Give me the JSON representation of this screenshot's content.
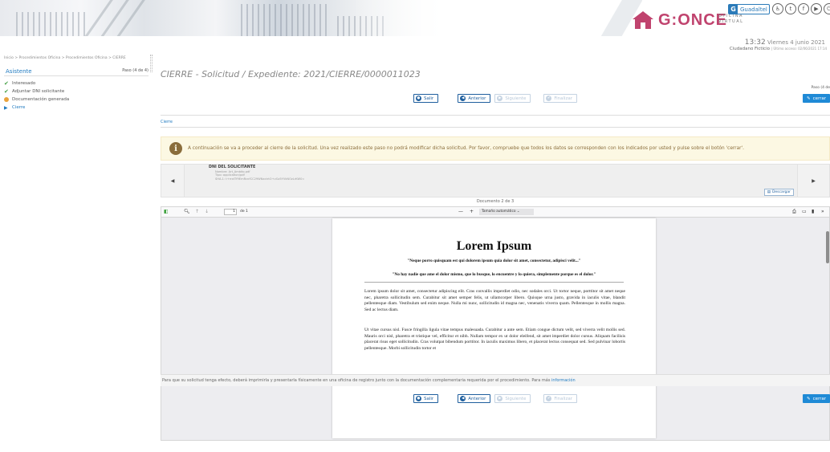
{
  "header": {
    "logo_text": "G:ONCE",
    "logo_sub": [
      "OFICINA",
      "VIRTUAL"
    ],
    "guadaltel": "Guadaltel",
    "social_icons": [
      "accessibility-icon",
      "twitter-icon",
      "facebook-icon",
      "youtube-icon",
      "power-icon"
    ],
    "time": "13:32",
    "date": "Viernes 4 junio 2021",
    "citizen": "Ciudadano Ficticio",
    "last_access": "Último acceso: 02/06/2021 17:14"
  },
  "sidebar": {
    "breadcrumb": "Inicio > Procedimientos Oficina > Procedimientos Oficina > CIERRE",
    "title": "Asistente",
    "step_counter": "Paso (4 de 4)",
    "steps": [
      {
        "label": "Interesado",
        "status": "done"
      },
      {
        "label": "Adjuntar DNI solicitante",
        "status": "done"
      },
      {
        "label": "Documentación generada",
        "status": "warning"
      },
      {
        "label": "Cierre",
        "status": "active"
      }
    ]
  },
  "main": {
    "title": "CIERRE - Solicitud / Expediente: 2021/CIERRE/0000011023",
    "paso": "Paso (4 de",
    "buttons": {
      "salir": "Salir",
      "anterior": "Anterior",
      "siguiente": "Siguiente",
      "finalizar": "Finalizar",
      "cerrar": "cerrar"
    },
    "tab": "Cierre",
    "alert": "A continuación se va a proceder al cierre de la solicitud. Una vez realizado este paso no podrá modificar dicha solicitud. Por favor, compruebe que todos los datos se corresponden con los indicados por usted y pulse sobre el botón 'cerrar'.",
    "document": {
      "name": "DNI DEL SOLICITANTE",
      "meta_nombre": "Nombre: Art_Ambito.pdf",
      "meta_tipo": "Tipo: application/pdf",
      "meta_sha": "SHA-1: t+rrxtTf9EmRcnfCC29WNxctrtO+vGz5YVkNOzLrKW0=",
      "descargar": "Descargar",
      "count": "Documento 2 de 3"
    },
    "viewer": {
      "page_value": "1",
      "page_total": "de 1",
      "zoom": "Tamaño automático",
      "pdf_title": "Lorem Ipsum",
      "quote1": "\"Neque porro quisquam est qui dolorem ipsum quia dolor sit amet, consectetur, adipisci velit...\"",
      "quote2": "\"No hay nadie que ame el dolor mismo, que lo busque, lo encuentre y lo quiera, simplemente porque es el dolor.\"",
      "para1": "Lorem ipsum dolor sit amet, consectetur adipiscing elit. Cras convallis imperdiet odio, nec sodales orci. Ut tortor neque, porttitor sit amet neque nec, pharetra sollicitudin sem. Curabitur sit amet semper felis, ut ullamcorper libero. Quisque urna justo, gravida in iaculis vitae, blandit pellentesque diam. Vestibulum sed enim neque. Nulla mi nunc, sollicitudin id magna nec, venenatis viverra quam. Pellentesque in mollis magna. Sed ac lectus diam.",
      "para2": "Ut vitae cursus nisl. Fusce fringilla ligula vitae tempus malesuada. Curabitur a ante sem. Etiam congue dictum velit, sed viverra velit mollis sed. Mauris orci nisl, pharetra et tristique vel, efficitur et nibh. Nullam tempor ex ut dolor eleifend, sit amet imperdiet dolor cursus. Aliquam facilisis placerat risus eget sollicitudin. Cras volutpat bibendum porttitor. In iaculis maximus libero, et placerat lectus consequat sed. Sed pulvinar lobortis pellentesque. Morbi sollicitudin tortor et"
    },
    "footer_text": "Para que su solicitud tenga efecto, deberá imprimirla y presentarla físicamente en una oficina de registro junto con la documentación complementaria requerida por el procedimiento. Para más ",
    "footer_link": "información"
  },
  "colors": {
    "brand": "#c0436e",
    "primary": "#1f5f9e",
    "accent": "#1f8ad6",
    "alert_bg": "#fcf8e3",
    "alert_text": "#8a6d3b",
    "success": "#46a046",
    "warning": "#e9a23b"
  }
}
